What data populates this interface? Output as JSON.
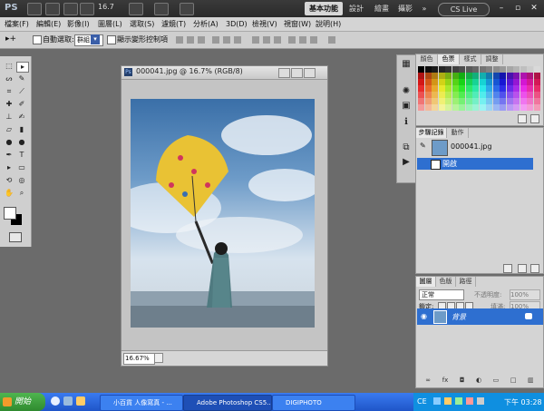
{
  "app": {
    "logo": "PS",
    "zoom": "16.7",
    "cs_live": "CS Live"
  },
  "workspaces": {
    "basic": "基本功能",
    "design": "設計",
    "painting": "繪畫",
    "photography": "攝影",
    "more": "»"
  },
  "window_controls": {
    "minimize": "–",
    "restore": "▫",
    "close": "✕"
  },
  "menu": [
    "檔案(F)",
    "編輯(E)",
    "影像(I)",
    "圖層(L)",
    "選取(S)",
    "濾鏡(T)",
    "分析(A)",
    "3D(D)",
    "檢視(V)",
    "視窗(W)",
    "說明(H)"
  ],
  "options": {
    "auto_select": "自動選取:",
    "auto_select_value": "群組",
    "show_transform": "顯示變形控制項"
  },
  "document": {
    "title": "000041.jpg @ 16.7% (RGB/8)",
    "zoom_field": "16.67%"
  },
  "panels": {
    "swatch_tabs": [
      "顏色",
      "色票",
      "樣式",
      "調整"
    ],
    "history_tabs": [
      "步驟記錄",
      "動作"
    ],
    "history_snapshot": "000041.jpg",
    "history_step": "開啟",
    "layers_tabs": [
      "圖層",
      "色版",
      "路徑"
    ],
    "blend_mode": "正常",
    "opacity_label": "不透明度:",
    "opacity_value": "100%",
    "lock_label": "鎖定:",
    "fill_label": "填滿:",
    "fill_value": "100%",
    "layer_name": "背景"
  },
  "taskbar": {
    "start": "開始",
    "tasks": [
      "小百貨 人像寫真 - ...",
      "Adobe Photoshop CS5...",
      "DIGIPHOTO"
    ],
    "lang": "CE",
    "clock": "下午 03:28"
  },
  "colors": {
    "accent": "#2e6fd0",
    "taskbar": "#245edb",
    "start": "#3c9a3c"
  }
}
